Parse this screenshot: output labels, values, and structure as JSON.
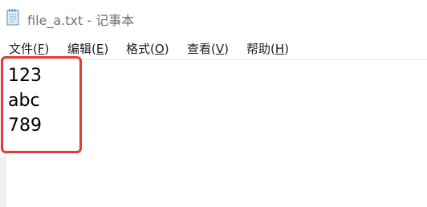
{
  "window": {
    "title": "file_a.txt - 记事本",
    "icon": "notepad-icon"
  },
  "menu": {
    "items": [
      {
        "name": "文件",
        "key": "F"
      },
      {
        "name": "编辑",
        "key": "E"
      },
      {
        "name": "格式",
        "key": "O"
      },
      {
        "name": "查看",
        "key": "V"
      },
      {
        "name": "帮助",
        "key": "H"
      }
    ]
  },
  "document": {
    "lines": [
      "123",
      "abc",
      "789"
    ]
  },
  "annotation": {
    "color": "#e53935"
  }
}
